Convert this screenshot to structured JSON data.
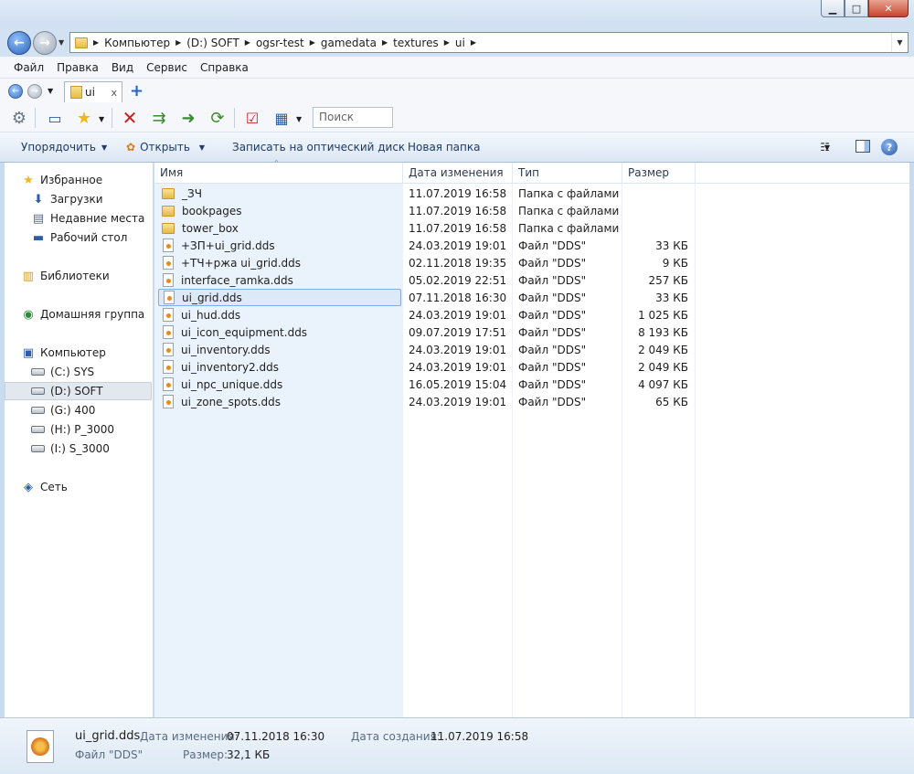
{
  "window": {
    "minimize_glyph": "▁",
    "maximize_glyph": "□",
    "close_glyph": "✕"
  },
  "address": {
    "crumbs": [
      "Компьютер",
      "(D:) SOFT",
      "ogsr-test",
      "gamedata",
      "textures",
      "ui"
    ]
  },
  "menu": [
    "Файл",
    "Правка",
    "Вид",
    "Сервис",
    "Справка"
  ],
  "tab": {
    "label": "ui",
    "close": "x",
    "add": "+"
  },
  "toolbar": {
    "search_placeholder": "Поиск",
    "icons": [
      "gear-icon",
      "monitor-icon",
      "star-icon",
      "delete-icon",
      "copy-icon",
      "move-icon",
      "refresh-icon",
      "checklist-icon",
      "view-grid-icon"
    ]
  },
  "commands": {
    "organize": "Упорядочить",
    "open": "Открыть",
    "burn": "Записать на оптический диск",
    "new_folder": "Новая папка"
  },
  "nav": {
    "favorites": "Избранное",
    "downloads": "Загрузки",
    "recent": "Недавние места",
    "desktop": "Рабочий стол",
    "libraries": "Библиотеки",
    "homegroup": "Домашняя группа",
    "computer": "Компьютер",
    "drives": [
      "(C:) SYS",
      "(D:) SOFT",
      "(G:) 400",
      "(H:) P_3000",
      "(I:) S_3000"
    ],
    "network": "Сеть"
  },
  "columns": {
    "name": "Имя",
    "date": "Дата изменения",
    "type": "Тип",
    "size": "Размер"
  },
  "files": [
    {
      "name": "_ЗЧ",
      "date": "11.07.2019 16:58",
      "type": "Папка с файлами",
      "size": "",
      "kind": "folder"
    },
    {
      "name": "bookpages",
      "date": "11.07.2019 16:58",
      "type": "Папка с файлами",
      "size": "",
      "kind": "folder"
    },
    {
      "name": "tower_box",
      "date": "11.07.2019 16:58",
      "type": "Папка с файлами",
      "size": "",
      "kind": "folder"
    },
    {
      "name": "+ЗП+ui_grid.dds",
      "date": "24.03.2019 19:01",
      "type": "Файл \"DDS\"",
      "size": "33 КБ",
      "kind": "file"
    },
    {
      "name": "+ТЧ+ржа ui_grid.dds",
      "date": "02.11.2018 19:35",
      "type": "Файл \"DDS\"",
      "size": "9 КБ",
      "kind": "file"
    },
    {
      "name": "interface_ramka.dds",
      "date": "05.02.2019 22:51",
      "type": "Файл \"DDS\"",
      "size": "257 КБ",
      "kind": "file"
    },
    {
      "name": "ui_grid.dds",
      "date": "07.11.2018 16:30",
      "type": "Файл \"DDS\"",
      "size": "33 КБ",
      "kind": "file"
    },
    {
      "name": "ui_hud.dds",
      "date": "24.03.2019 19:01",
      "type": "Файл \"DDS\"",
      "size": "1 025 КБ",
      "kind": "file"
    },
    {
      "name": "ui_icon_equipment.dds",
      "date": "09.07.2019 17:51",
      "type": "Файл \"DDS\"",
      "size": "8 193 КБ",
      "kind": "file"
    },
    {
      "name": "ui_inventory.dds",
      "date": "24.03.2019 19:01",
      "type": "Файл \"DDS\"",
      "size": "2 049 КБ",
      "kind": "file"
    },
    {
      "name": "ui_inventory2.dds",
      "date": "24.03.2019 19:01",
      "type": "Файл \"DDS\"",
      "size": "2 049 КБ",
      "kind": "file"
    },
    {
      "name": "ui_npc_unique.dds",
      "date": "16.05.2019 15:04",
      "type": "Файл \"DDS\"",
      "size": "4 097 КБ",
      "kind": "file"
    },
    {
      "name": "ui_zone_spots.dds",
      "date": "24.03.2019 19:01",
      "type": "Файл \"DDS\"",
      "size": "65 КБ",
      "kind": "file"
    }
  ],
  "selected_file": "ui_grid.dds",
  "details": {
    "name": "ui_grid.dds",
    "type": "Файл \"DDS\"",
    "modified_label": "Дата изменения:",
    "modified": "07.11.2018 16:30",
    "created_label": "Дата создания:",
    "created": "11.07.2019 16:58",
    "size_label": "Размер:",
    "size": "32,1 КБ"
  },
  "colors": {
    "selection": "#dbe9f8",
    "accent": "#2a64c5"
  }
}
